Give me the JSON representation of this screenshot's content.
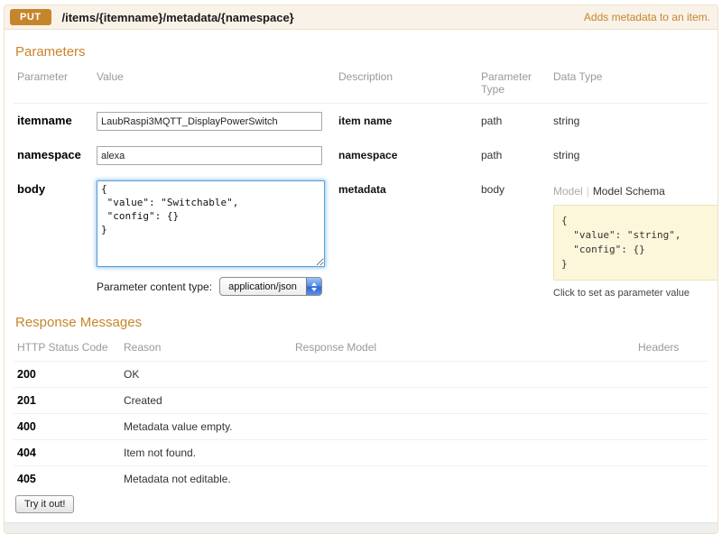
{
  "endpoint": {
    "method": "PUT",
    "path": "/items/{itemname}/metadata/{namespace}",
    "summary": "Adds metadata to an item."
  },
  "parameters_section": {
    "heading": "Parameters",
    "columns": {
      "parameter": "Parameter",
      "value": "Value",
      "description": "Description",
      "parameter_type": "Parameter Type",
      "data_type": "Data Type"
    },
    "rows": [
      {
        "name": "itemname",
        "value": "LaubRaspi3MQTT_DisplayPowerSwitch",
        "description": "item name",
        "param_type": "path",
        "data_type": "string"
      },
      {
        "name": "namespace",
        "value": "alexa",
        "description": "namespace",
        "param_type": "path",
        "data_type": "string"
      },
      {
        "name": "body",
        "value": "{\n \"value\": \"Switchable\",\n \"config\": {}\n}",
        "description": "metadata",
        "param_type": "body"
      }
    ],
    "content_type_label": "Parameter content type:",
    "content_type_value": "application/json",
    "model_tabs": {
      "model": "Model",
      "separator": "|",
      "schema": "Model Schema"
    },
    "model_schema_snippet": "{\n  \"value\": \"string\",\n  \"config\": {}\n}",
    "snippet_hint": "Click to set as parameter value"
  },
  "responses_section": {
    "heading": "Response Messages",
    "columns": {
      "code": "HTTP Status Code",
      "reason": "Reason",
      "model": "Response Model",
      "headers": "Headers"
    },
    "rows": [
      {
        "code": "200",
        "reason": "OK"
      },
      {
        "code": "201",
        "reason": "Created"
      },
      {
        "code": "400",
        "reason": "Metadata value empty."
      },
      {
        "code": "404",
        "reason": "Item not found."
      },
      {
        "code": "405",
        "reason": "Metadata not editable."
      }
    ],
    "try_it_label": "Try it out!"
  },
  "colors": {
    "accent": "#c5862b",
    "header_bg": "#f9f2e9",
    "header_border": "#f0e0ca",
    "snippet_bg": "#fcf6db",
    "focus_blue": "#5b9dd9"
  }
}
